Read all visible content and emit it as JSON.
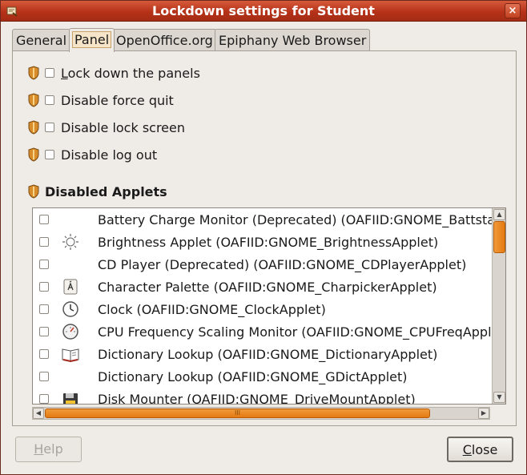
{
  "window": {
    "title": "Lockdown settings for Student",
    "close_glyph": "×"
  },
  "tabs": [
    {
      "label": "General",
      "active": false
    },
    {
      "label": "Panel",
      "active": true
    },
    {
      "label": "OpenOffice.org",
      "active": false
    },
    {
      "label": "Epiphany Web Browser",
      "active": false
    }
  ],
  "options": [
    {
      "mnemonic": "L",
      "rest": "ock down the panels",
      "checked": false
    },
    {
      "mnemonic": "",
      "rest": "Disable force quit",
      "checked": false
    },
    {
      "mnemonic": "",
      "rest": "Disable lock screen",
      "checked": false
    },
    {
      "mnemonic": "",
      "rest": "Disable log out",
      "checked": false
    }
  ],
  "applets_section": {
    "title": "Disabled Applets"
  },
  "applets": [
    {
      "label": "Battery Charge Monitor (Deprecated) (OAFIID:GNOME_BattstatusApplet)",
      "icon": "none",
      "checked": false
    },
    {
      "label": "Brightness Applet (OAFIID:GNOME_BrightnessApplet)",
      "icon": "brightness-icon",
      "checked": false
    },
    {
      "label": "CD Player (Deprecated) (OAFIID:GNOME_CDPlayerApplet)",
      "icon": "none",
      "checked": false
    },
    {
      "label": "Character Palette (OAFIID:GNOME_CharpickerApplet)",
      "icon": "character-palette-icon",
      "checked": false
    },
    {
      "label": "Clock (OAFIID:GNOME_ClockApplet)",
      "icon": "clock-icon",
      "checked": false
    },
    {
      "label": "CPU Frequency Scaling Monitor (OAFIID:GNOME_CPUFreqApplet)",
      "icon": "cpu-frequency-icon",
      "checked": false
    },
    {
      "label": "Dictionary Lookup (OAFIID:GNOME_DictionaryApplet)",
      "icon": "dictionary-icon",
      "checked": false
    },
    {
      "label": "Dictionary Lookup (OAFIID:GNOME_GDictApplet)",
      "icon": "none",
      "checked": false
    },
    {
      "label": "Disk Mounter (OAFIID:GNOME_DriveMountApplet)",
      "icon": "floppy-disk-icon",
      "checked": false
    }
  ],
  "horizontal_scroll_grip": "III",
  "buttons": {
    "help": {
      "mnemonic": "H",
      "rest": "elp",
      "enabled": false
    },
    "close": {
      "mnemonic": "C",
      "rest": "lose",
      "enabled": true
    }
  },
  "colors": {
    "titlebar": "#b63219",
    "accent": "#e57a12",
    "window_bg": "#efebe7"
  }
}
